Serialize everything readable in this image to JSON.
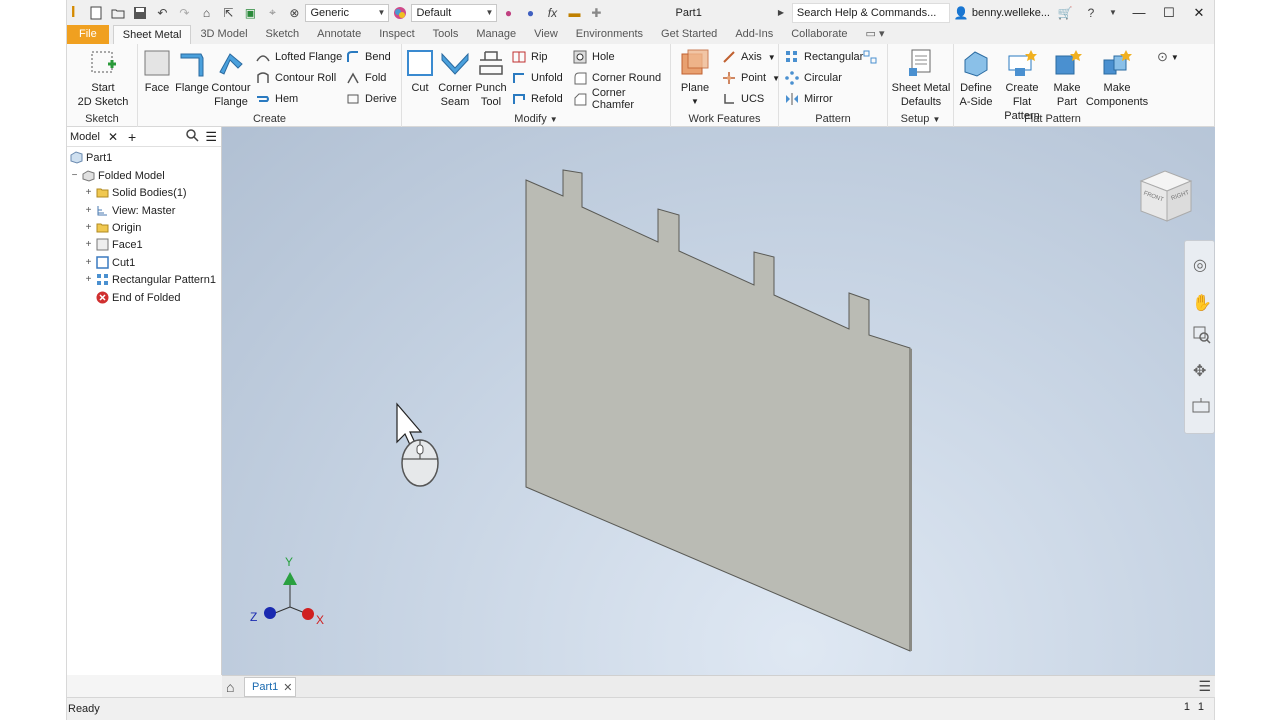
{
  "window": {
    "title": "Part1",
    "material_dropdown": "Generic",
    "appearance_dropdown": "Default",
    "search_placeholder": "Search Help & Commands...",
    "user": "benny.welleke..."
  },
  "tabs": [
    "File",
    "Sheet Metal",
    "3D Model",
    "Sketch",
    "Annotate",
    "Inspect",
    "Tools",
    "Manage",
    "View",
    "Environments",
    "Get Started",
    "Add-Ins",
    "Collaborate"
  ],
  "active_tab": "Sheet Metal",
  "ribbon": {
    "sketch": {
      "title": "Sketch",
      "start_sketch_1": "Start",
      "start_sketch_2": "2D Sketch"
    },
    "create": {
      "title": "Create",
      "face": "Face",
      "flange": "Flange",
      "contour_flange_1": "Contour",
      "contour_flange_2": "Flange",
      "lofted_flange": "Lofted Flange",
      "contour_roll": "Contour Roll",
      "hem": "Hem",
      "bend": "Bend",
      "fold": "Fold",
      "derive": "Derive"
    },
    "modify": {
      "title": "Modify",
      "cut": "Cut",
      "corner_seam_1": "Corner",
      "corner_seam_2": "Seam",
      "punch_tool_1": "Punch",
      "punch_tool_2": "Tool",
      "rip": "Rip",
      "unfold": "Unfold",
      "refold": "Refold",
      "hole": "Hole",
      "corner_round": "Corner Round",
      "corner_chamfer": "Corner Chamfer"
    },
    "work_features": {
      "title": "Work Features",
      "plane": "Plane",
      "axis": "Axis",
      "point": "Point",
      "ucs": "UCS"
    },
    "pattern": {
      "title": "Pattern",
      "rectangular": "Rectangular",
      "circular": "Circular",
      "mirror": "Mirror"
    },
    "setup": {
      "title": "Setup",
      "defaults_1": "Sheet Metal",
      "defaults_2": "Defaults"
    },
    "flat_pattern": {
      "title": "Flat Pattern",
      "define_1": "Define",
      "define_2": "A-Side",
      "create_1": "Create",
      "create_2": "Flat Pattern",
      "make_part_1": "Make",
      "make_part_2": "Part",
      "make_comp_1": "Make",
      "make_comp_2": "Components"
    }
  },
  "browser": {
    "tab_label": "Model",
    "root": "Part1",
    "items": [
      {
        "label": "Folded Model",
        "icon": "folded-model-icon"
      },
      {
        "label": "Solid Bodies(1)",
        "icon": "folder-icon"
      },
      {
        "label": "View: Master",
        "icon": "view-icon"
      },
      {
        "label": "Origin",
        "icon": "folder-icon"
      },
      {
        "label": "Face1",
        "icon": "face-icon"
      },
      {
        "label": "Cut1",
        "icon": "cut-icon"
      },
      {
        "label": "Rectangular Pattern1",
        "icon": "pattern-icon"
      },
      {
        "label": "End of Folded",
        "icon": "end-of-part-icon"
      }
    ]
  },
  "viewcube": {
    "front": "FRONT",
    "right": "RIGHT"
  },
  "triad": {
    "x": "X",
    "y": "Y",
    "z": "Z"
  },
  "doc_tab": "Part1",
  "status": {
    "text": "Ready",
    "count_1": "1",
    "count_2": "1"
  }
}
